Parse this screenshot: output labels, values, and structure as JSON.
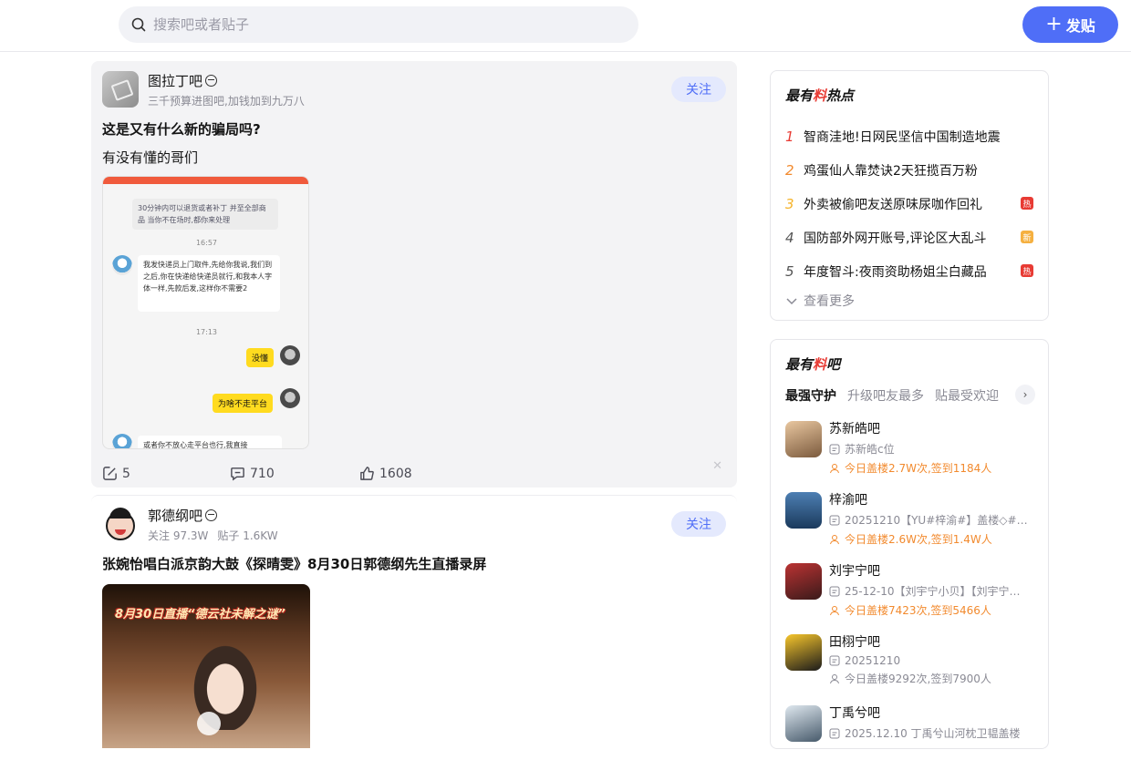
{
  "search": {
    "placeholder": "搜索吧或者贴子"
  },
  "post_button": {
    "label": "发贴"
  },
  "posts": [
    {
      "bar_name": "图拉丁吧",
      "bar_sub": "三千预算进图吧,加钱加到九万八",
      "follow": "关注",
      "title": "这是又有什么新的骗局吗?",
      "body": "有没有懂的哥们",
      "chat": {
        "note": "30分钟内可以退货或者补丁 并至全部商品 当你不在场时,都你来处理",
        "time1": "16:57",
        "msg1": "我发快递员上门取件,先给你我说,我们到之后,你在快递给快递员就行,和我本人字体一样,先款后发,这样你不需要2",
        "time2": "17:13",
        "reply1": "没懂",
        "reply2": "为啥不走平台",
        "msg2": "或者你不放心走平台也行,我直接"
      },
      "repost": "5",
      "comments": "710",
      "likes": "1608"
    },
    {
      "bar_name": "郭德纲吧",
      "follow_count": "关注 97.3W",
      "post_count": "贴子 1.6KW",
      "follow": "关注",
      "title": "张婉怡唱白派京韵大鼓《探晴雯》8月30日郭德纲先生直播录屏",
      "video_banner": "8月30日直播“德云社未解之谜”"
    }
  ],
  "hot": {
    "title_a": "最有",
    "title_mark": "料",
    "title_b": "热点",
    "items": [
      {
        "rank": "1",
        "text": "智商洼地!日网民坚信中国制造地震",
        "tag": ""
      },
      {
        "rank": "2",
        "text": "鸡蛋仙人靠焚诀2天狂揽百万粉",
        "tag": ""
      },
      {
        "rank": "3",
        "text": "外卖被偷吧友送原味尿咖作回礼",
        "tag": "热"
      },
      {
        "rank": "4",
        "text": "国防部外网开账号,评论区大乱斗",
        "tag": "新"
      },
      {
        "rank": "5",
        "text": "年度智斗:夜雨资助杨姐尘白藏品",
        "tag": "热"
      }
    ],
    "more": "查看更多"
  },
  "bars": {
    "title_a": "最有",
    "title_mark": "料",
    "title_b": "吧",
    "tabs": [
      "最强守护",
      "升级吧友最多",
      "贴最受欢迎"
    ],
    "items": [
      {
        "name": "苏新皓吧",
        "desc": "苏新皓c位",
        "stats": "今日盖楼2.7W次,签到1184人",
        "highlight": true
      },
      {
        "name": "梓渝吧",
        "desc": "20251210【YU#梓渝#】盖楼◇#网…",
        "stats": "今日盖楼2.6W次,签到1.4W人",
        "highlight": true
      },
      {
        "name": "刘宇宁吧",
        "desc": "25-12-10【刘宇宁小贝】【刘宇宁吧…",
        "stats": "今日盖楼7423次,签到5466人",
        "highlight": true
      },
      {
        "name": "田栩宁吧",
        "desc": "20251210",
        "stats": "今日盖楼9292次,签到7900人",
        "highlight": false
      },
      {
        "name": "丁禹兮吧",
        "desc": "2025.12.10 丁禹兮山河枕卫韫盖楼",
        "stats": "",
        "highlight": false
      }
    ]
  }
}
